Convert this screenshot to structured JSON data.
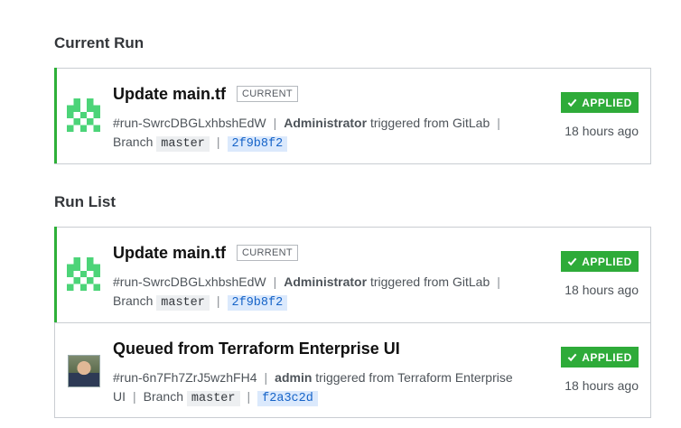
{
  "current_section": {
    "title": "Current Run",
    "run": {
      "title": "Update main.tf",
      "badge": "CURRENT",
      "run_id": "#run-SwrcDBGLxhbshEdW",
      "user": "Administrator",
      "trigger_text": "triggered from GitLab",
      "branch_label": "Branch",
      "branch": "master",
      "commit": "2f9b8f2",
      "status": "APPLIED",
      "time": "18 hours ago"
    }
  },
  "list_section": {
    "title": "Run List",
    "runs": [
      {
        "title": "Update main.tf",
        "badge": "CURRENT",
        "run_id": "#run-SwrcDBGLxhbshEdW",
        "user": "Administrator",
        "trigger_text": "triggered from GitLab",
        "branch_label": "Branch",
        "branch": "master",
        "commit": "2f9b8f2",
        "status": "APPLIED",
        "time": "18 hours ago"
      },
      {
        "title": "Queued from Terraform Enterprise UI",
        "run_id": "#run-6n7Fh7ZrJ5wzhFH4",
        "user": "admin",
        "trigger_text": "triggered from Terraform Enterprise UI",
        "branch_label": "Branch",
        "branch": "master",
        "commit": "f2a3c2d",
        "status": "APPLIED",
        "time": "18 hours ago"
      }
    ]
  },
  "colors": {
    "accent_green": "#2eb039",
    "status_green": "#2eab39",
    "commit_blue": "#1563c8"
  },
  "icons": {
    "avatar_identicon": "identicon-avatar-icon",
    "status_check": "checkmark-icon",
    "user_photo": "user-photo-avatar"
  }
}
